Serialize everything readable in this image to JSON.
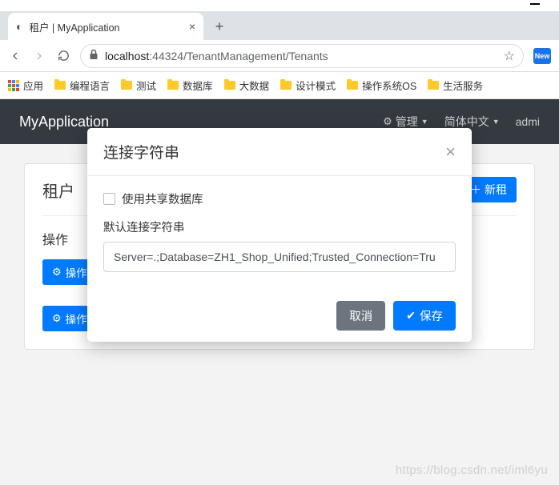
{
  "window": {
    "minimize": "—"
  },
  "tab": {
    "title": "租户 | MyApplication"
  },
  "url": {
    "host": "localhost",
    "port": ":44324",
    "path": "/TenantManagement/Tenants"
  },
  "extension": {
    "label": "New"
  },
  "bookmarks": {
    "apps": "应用",
    "items": [
      "编程语言",
      "测试",
      "数据库",
      "大数据",
      "设计模式",
      "操作系统OS",
      "生活服务"
    ]
  },
  "navbar": {
    "brand": "MyApplication",
    "manage": "管理",
    "lang": "简体中文",
    "user": "admi"
  },
  "card": {
    "title": "租户",
    "new_btn": "新租",
    "ops_label": "操作",
    "action_btn": "操作"
  },
  "modal": {
    "title": "连接字符串",
    "checkbox_label": "使用共享数据库",
    "field_label": "默认连接字符串",
    "input_value": "Server=.;Database=ZH1_Shop_Unified;Trusted_Connection=Tru",
    "cancel": "取消",
    "save": "保存"
  },
  "watermark": "https://blog.csdn.net/iml6yu"
}
